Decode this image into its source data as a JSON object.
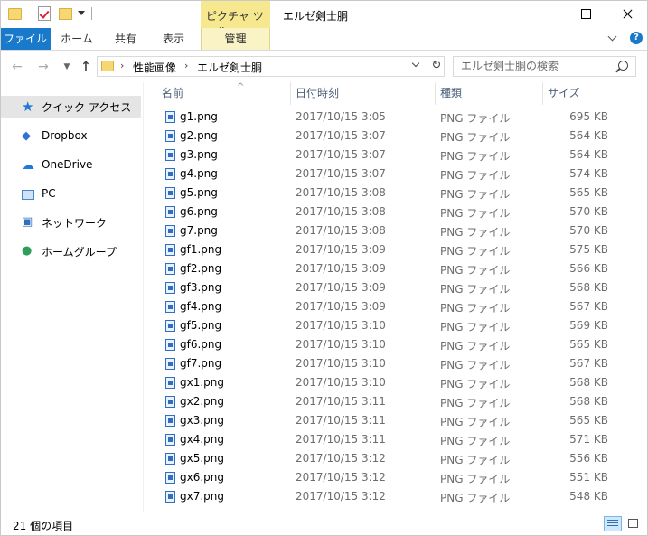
{
  "titlebar": {
    "context_tab_header": "ピクチャ ツール",
    "window_title": "エルゼ剣士胴"
  },
  "ribbon": {
    "tabs": [
      {
        "label": "ファイル"
      },
      {
        "label": "ホーム"
      },
      {
        "label": "共有"
      },
      {
        "label": "表示"
      },
      {
        "label": "管理"
      }
    ],
    "help_label": "?"
  },
  "navbar": {
    "breadcrumb": [
      "性能画像",
      "エルゼ剣士胴"
    ],
    "separator": "›",
    "search_placeholder": "エルゼ剣士胴の検索"
  },
  "sidebar": {
    "items": [
      {
        "label": "クイック アクセス",
        "icon": "quick-access-star-icon",
        "active": true
      },
      {
        "label": "Dropbox",
        "icon": "dropbox-icon"
      },
      {
        "label": "OneDrive",
        "icon": "onedrive-cloud-icon"
      },
      {
        "label": "PC",
        "icon": "pc-monitor-icon"
      },
      {
        "label": "ネットワーク",
        "icon": "network-icon"
      },
      {
        "label": "ホームグループ",
        "icon": "homegroup-icon"
      }
    ]
  },
  "filelist": {
    "columns": [
      "名前",
      "日付時刻",
      "種類",
      "サイズ"
    ],
    "sorted_column": "名前",
    "rows": [
      {
        "name": "g1.png",
        "date": "2017/10/15 3:05",
        "type": "PNG ファイル",
        "size": "695 KB"
      },
      {
        "name": "g2.png",
        "date": "2017/10/15 3:07",
        "type": "PNG ファイル",
        "size": "564 KB"
      },
      {
        "name": "g3.png",
        "date": "2017/10/15 3:07",
        "type": "PNG ファイル",
        "size": "564 KB"
      },
      {
        "name": "g4.png",
        "date": "2017/10/15 3:07",
        "type": "PNG ファイル",
        "size": "574 KB"
      },
      {
        "name": "g5.png",
        "date": "2017/10/15 3:08",
        "type": "PNG ファイル",
        "size": "565 KB"
      },
      {
        "name": "g6.png",
        "date": "2017/10/15 3:08",
        "type": "PNG ファイル",
        "size": "570 KB"
      },
      {
        "name": "g7.png",
        "date": "2017/10/15 3:08",
        "type": "PNG ファイル",
        "size": "570 KB"
      },
      {
        "name": "gf1.png",
        "date": "2017/10/15 3:09",
        "type": "PNG ファイル",
        "size": "575 KB"
      },
      {
        "name": "gf2.png",
        "date": "2017/10/15 3:09",
        "type": "PNG ファイル",
        "size": "566 KB"
      },
      {
        "name": "gf3.png",
        "date": "2017/10/15 3:09",
        "type": "PNG ファイル",
        "size": "568 KB"
      },
      {
        "name": "gf4.png",
        "date": "2017/10/15 3:09",
        "type": "PNG ファイル",
        "size": "567 KB"
      },
      {
        "name": "gf5.png",
        "date": "2017/10/15 3:10",
        "type": "PNG ファイル",
        "size": "569 KB"
      },
      {
        "name": "gf6.png",
        "date": "2017/10/15 3:10",
        "type": "PNG ファイル",
        "size": "565 KB"
      },
      {
        "name": "gf7.png",
        "date": "2017/10/15 3:10",
        "type": "PNG ファイル",
        "size": "567 KB"
      },
      {
        "name": "gx1.png",
        "date": "2017/10/15 3:10",
        "type": "PNG ファイル",
        "size": "568 KB"
      },
      {
        "name": "gx2.png",
        "date": "2017/10/15 3:11",
        "type": "PNG ファイル",
        "size": "568 KB"
      },
      {
        "name": "gx3.png",
        "date": "2017/10/15 3:11",
        "type": "PNG ファイル",
        "size": "565 KB"
      },
      {
        "name": "gx4.png",
        "date": "2017/10/15 3:11",
        "type": "PNG ファイル",
        "size": "571 KB"
      },
      {
        "name": "gx5.png",
        "date": "2017/10/15 3:12",
        "type": "PNG ファイル",
        "size": "556 KB"
      },
      {
        "name": "gx6.png",
        "date": "2017/10/15 3:12",
        "type": "PNG ファイル",
        "size": "551 KB"
      },
      {
        "name": "gx7.png",
        "date": "2017/10/15 3:12",
        "type": "PNG ファイル",
        "size": "548 KB"
      }
    ]
  },
  "statusbar": {
    "item_count": "21 個の項目"
  },
  "colors": {
    "file_tab": "#1979ca",
    "context_tab": "#f5e88e",
    "selected_sidebar": "#e5e5e5",
    "header_text": "#4c607a"
  }
}
